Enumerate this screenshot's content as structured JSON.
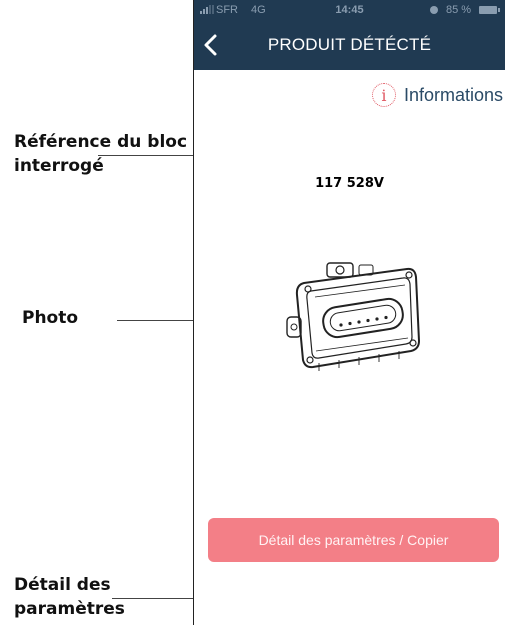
{
  "annotations": {
    "reference_label_line1": "Référence du bloc",
    "reference_label_line2": "interrogé",
    "photo_label": "Photo",
    "detail_label_line1": "Détail des",
    "detail_label_line2": "paramètres"
  },
  "status_bar": {
    "carrier": "SFR",
    "network": "4G",
    "time": "14:45",
    "battery": "85 %"
  },
  "nav": {
    "title": "PRODUIT DÉTÉCTÉ",
    "back_icon": "chevron-left-icon"
  },
  "info": {
    "icon": "info-icon",
    "icon_glyph": "i",
    "label": "Informations"
  },
  "product": {
    "reference": "117 528V"
  },
  "actions": {
    "detail_button_label": "Détail des paramètres / Copier"
  },
  "colors": {
    "nav_background": "#203a52",
    "accent": "#f37f87",
    "info_icon": "#e05a64"
  }
}
